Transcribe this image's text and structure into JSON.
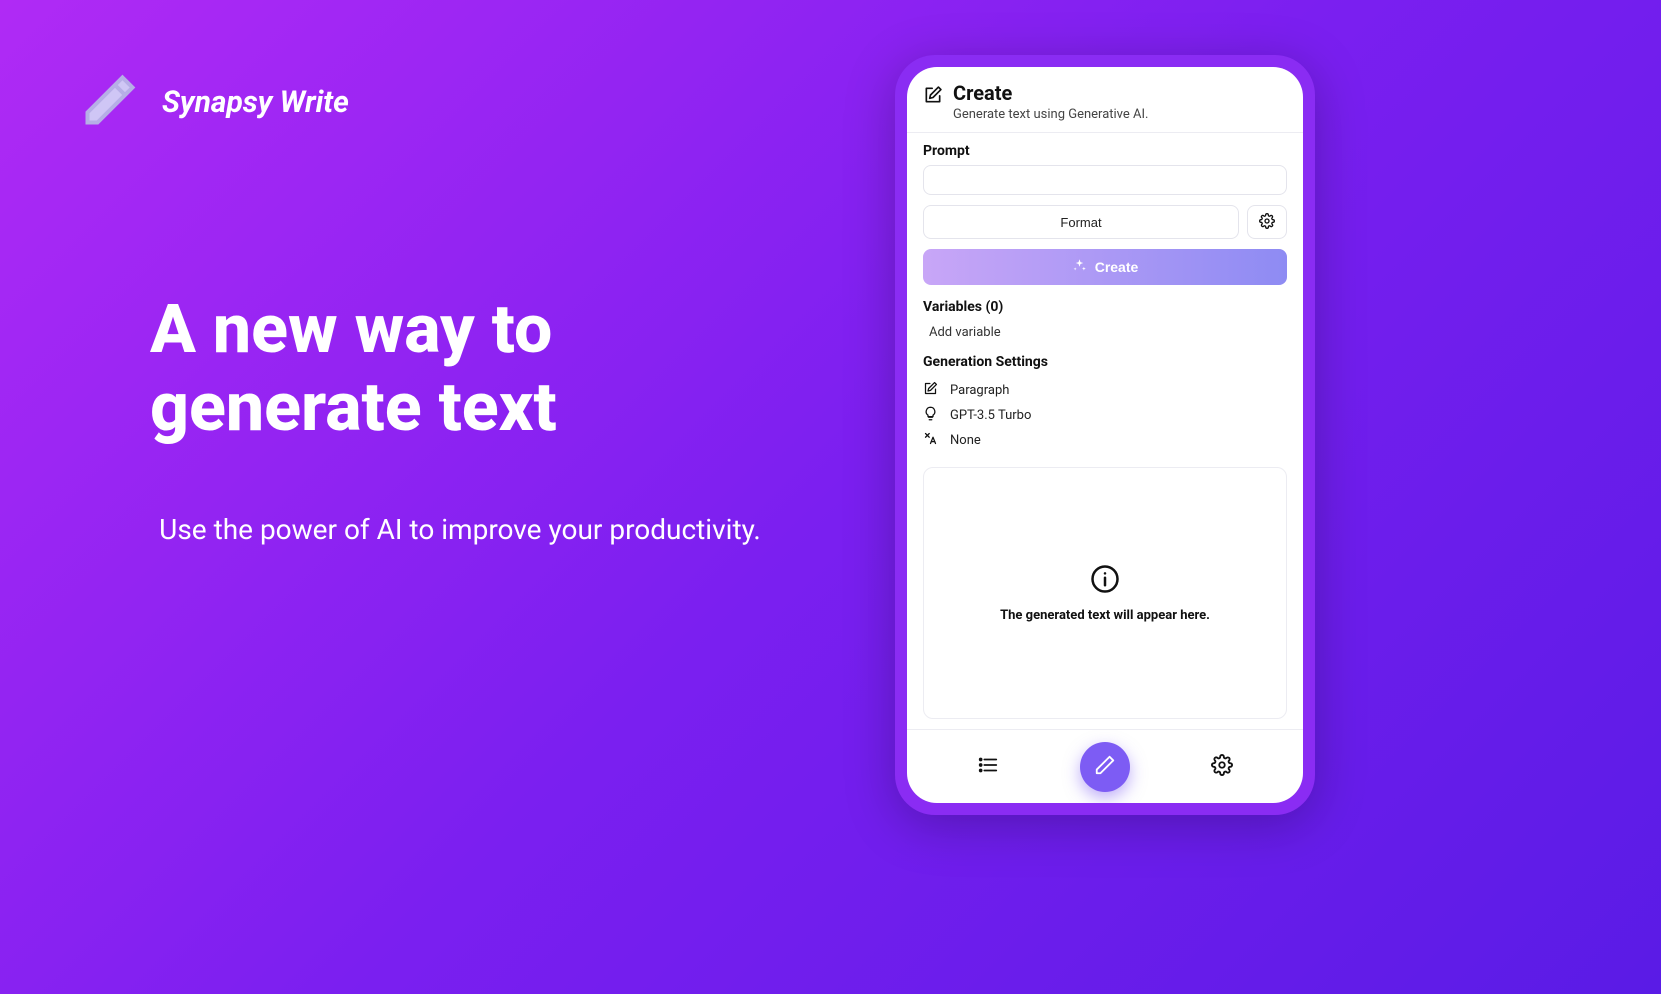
{
  "brand": {
    "name": "Synapsy Write"
  },
  "hero": {
    "headline": "A new way to generate text",
    "subhead": "Use the power of AI to improve your productivity."
  },
  "app": {
    "title": "Create",
    "subtitle": "Generate text using Generative AI.",
    "prompt_label": "Prompt",
    "format_button": "Format",
    "create_button": "Create",
    "variables_label": "Variables (0)",
    "add_variable": "Add variable",
    "settings_label": "Generation Settings",
    "settings": {
      "format": "Paragraph",
      "model": "GPT-3.5 Turbo",
      "tone": "None"
    },
    "output_placeholder": "The generated text will appear here."
  }
}
